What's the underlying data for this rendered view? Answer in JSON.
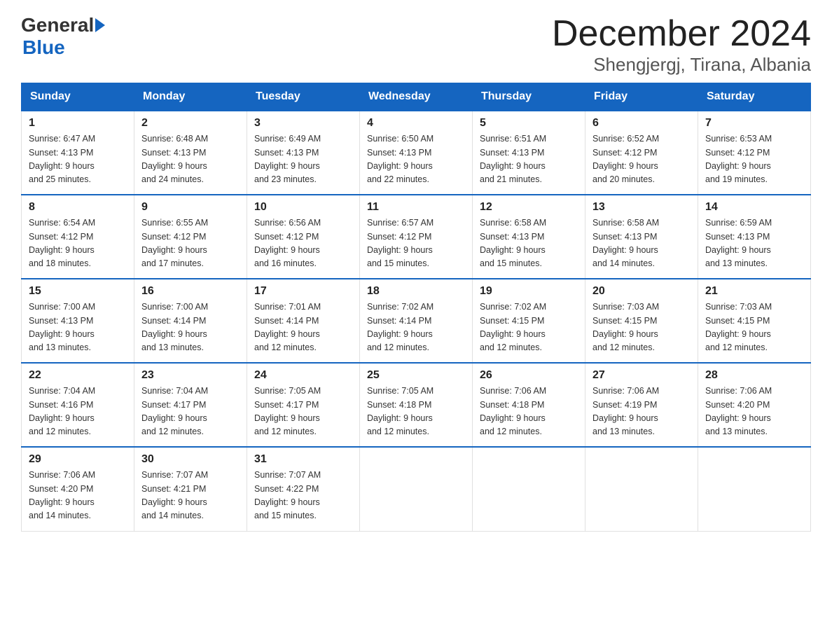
{
  "logo": {
    "text_general": "General",
    "text_blue": "Blue"
  },
  "title": {
    "month": "December 2024",
    "location": "Shengjergj, Tirana, Albania"
  },
  "weekdays": [
    "Sunday",
    "Monday",
    "Tuesday",
    "Wednesday",
    "Thursday",
    "Friday",
    "Saturday"
  ],
  "weeks": [
    [
      {
        "day": "1",
        "sunrise": "6:47 AM",
        "sunset": "4:13 PM",
        "daylight": "9 hours and 25 minutes."
      },
      {
        "day": "2",
        "sunrise": "6:48 AM",
        "sunset": "4:13 PM",
        "daylight": "9 hours and 24 minutes."
      },
      {
        "day": "3",
        "sunrise": "6:49 AM",
        "sunset": "4:13 PM",
        "daylight": "9 hours and 23 minutes."
      },
      {
        "day": "4",
        "sunrise": "6:50 AM",
        "sunset": "4:13 PM",
        "daylight": "9 hours and 22 minutes."
      },
      {
        "day": "5",
        "sunrise": "6:51 AM",
        "sunset": "4:13 PM",
        "daylight": "9 hours and 21 minutes."
      },
      {
        "day": "6",
        "sunrise": "6:52 AM",
        "sunset": "4:12 PM",
        "daylight": "9 hours and 20 minutes."
      },
      {
        "day": "7",
        "sunrise": "6:53 AM",
        "sunset": "4:12 PM",
        "daylight": "9 hours and 19 minutes."
      }
    ],
    [
      {
        "day": "8",
        "sunrise": "6:54 AM",
        "sunset": "4:12 PM",
        "daylight": "9 hours and 18 minutes."
      },
      {
        "day": "9",
        "sunrise": "6:55 AM",
        "sunset": "4:12 PM",
        "daylight": "9 hours and 17 minutes."
      },
      {
        "day": "10",
        "sunrise": "6:56 AM",
        "sunset": "4:12 PM",
        "daylight": "9 hours and 16 minutes."
      },
      {
        "day": "11",
        "sunrise": "6:57 AM",
        "sunset": "4:12 PM",
        "daylight": "9 hours and 15 minutes."
      },
      {
        "day": "12",
        "sunrise": "6:58 AM",
        "sunset": "4:13 PM",
        "daylight": "9 hours and 15 minutes."
      },
      {
        "day": "13",
        "sunrise": "6:58 AM",
        "sunset": "4:13 PM",
        "daylight": "9 hours and 14 minutes."
      },
      {
        "day": "14",
        "sunrise": "6:59 AM",
        "sunset": "4:13 PM",
        "daylight": "9 hours and 13 minutes."
      }
    ],
    [
      {
        "day": "15",
        "sunrise": "7:00 AM",
        "sunset": "4:13 PM",
        "daylight": "9 hours and 13 minutes."
      },
      {
        "day": "16",
        "sunrise": "7:00 AM",
        "sunset": "4:14 PM",
        "daylight": "9 hours and 13 minutes."
      },
      {
        "day": "17",
        "sunrise": "7:01 AM",
        "sunset": "4:14 PM",
        "daylight": "9 hours and 12 minutes."
      },
      {
        "day": "18",
        "sunrise": "7:02 AM",
        "sunset": "4:14 PM",
        "daylight": "9 hours and 12 minutes."
      },
      {
        "day": "19",
        "sunrise": "7:02 AM",
        "sunset": "4:15 PM",
        "daylight": "9 hours and 12 minutes."
      },
      {
        "day": "20",
        "sunrise": "7:03 AM",
        "sunset": "4:15 PM",
        "daylight": "9 hours and 12 minutes."
      },
      {
        "day": "21",
        "sunrise": "7:03 AM",
        "sunset": "4:15 PM",
        "daylight": "9 hours and 12 minutes."
      }
    ],
    [
      {
        "day": "22",
        "sunrise": "7:04 AM",
        "sunset": "4:16 PM",
        "daylight": "9 hours and 12 minutes."
      },
      {
        "day": "23",
        "sunrise": "7:04 AM",
        "sunset": "4:17 PM",
        "daylight": "9 hours and 12 minutes."
      },
      {
        "day": "24",
        "sunrise": "7:05 AM",
        "sunset": "4:17 PM",
        "daylight": "9 hours and 12 minutes."
      },
      {
        "day": "25",
        "sunrise": "7:05 AM",
        "sunset": "4:18 PM",
        "daylight": "9 hours and 12 minutes."
      },
      {
        "day": "26",
        "sunrise": "7:06 AM",
        "sunset": "4:18 PM",
        "daylight": "9 hours and 12 minutes."
      },
      {
        "day": "27",
        "sunrise": "7:06 AM",
        "sunset": "4:19 PM",
        "daylight": "9 hours and 13 minutes."
      },
      {
        "day": "28",
        "sunrise": "7:06 AM",
        "sunset": "4:20 PM",
        "daylight": "9 hours and 13 minutes."
      }
    ],
    [
      {
        "day": "29",
        "sunrise": "7:06 AM",
        "sunset": "4:20 PM",
        "daylight": "9 hours and 14 minutes."
      },
      {
        "day": "30",
        "sunrise": "7:07 AM",
        "sunset": "4:21 PM",
        "daylight": "9 hours and 14 minutes."
      },
      {
        "day": "31",
        "sunrise": "7:07 AM",
        "sunset": "4:22 PM",
        "daylight": "9 hours and 15 minutes."
      },
      null,
      null,
      null,
      null
    ]
  ],
  "labels": {
    "sunrise": "Sunrise:",
    "sunset": "Sunset:",
    "daylight": "Daylight:"
  }
}
